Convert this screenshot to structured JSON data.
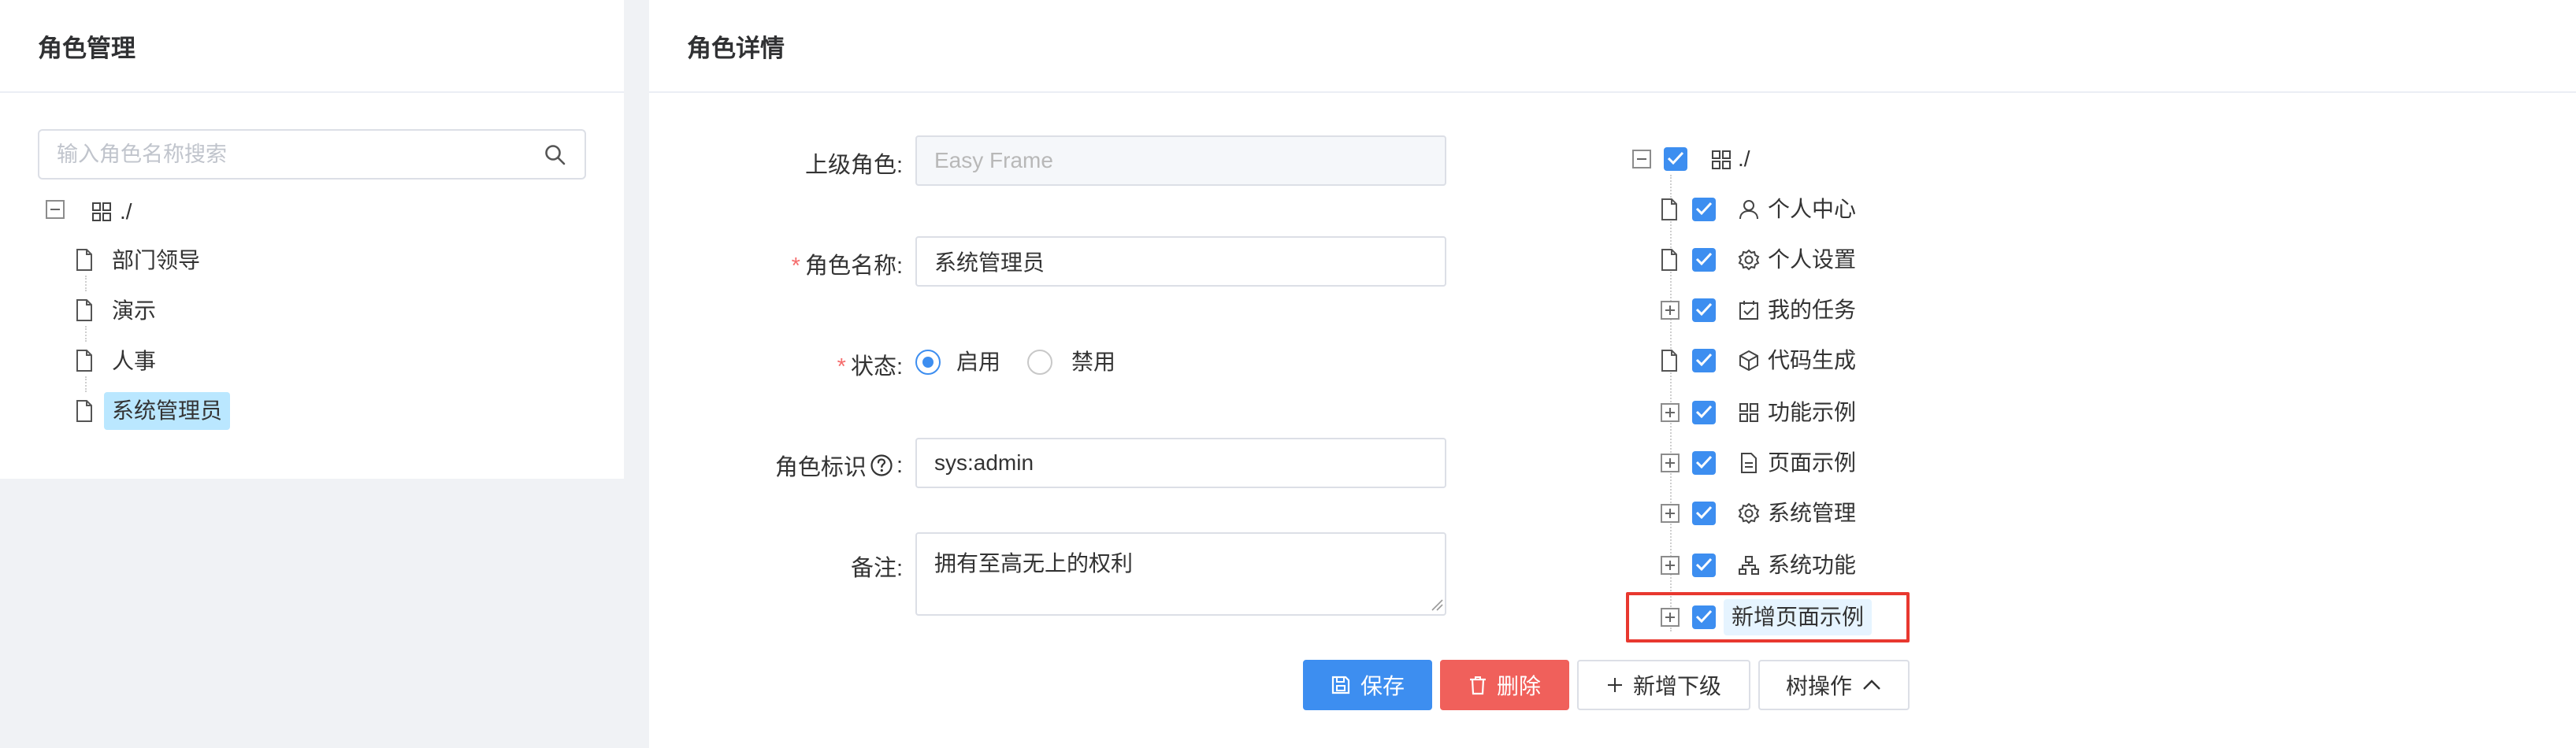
{
  "left_panel": {
    "title": "角色管理",
    "search": {
      "placeholder": "输入角色名称搜索",
      "value": ""
    },
    "tree": {
      "root_label": "./",
      "children": [
        "部门领导",
        "演示",
        "人事",
        "系统管理员"
      ],
      "selected": "系统管理员"
    }
  },
  "right_panel": {
    "title": "角色详情",
    "form": {
      "parent_role": {
        "label": "上级角色:",
        "value": "Easy Frame"
      },
      "role_name": {
        "label": "角色名称:",
        "required_mark": "*",
        "value": "系统管理员"
      },
      "status": {
        "label": "状态:",
        "required_mark": "*",
        "options": [
          "启用",
          "禁用"
        ],
        "selected": "启用"
      },
      "role_key": {
        "label": "角色标识",
        "colon": ":",
        "value": "sys:admin"
      },
      "remark": {
        "label": "备注:",
        "value": "拥有至高无上的权利"
      }
    },
    "perm_tree": {
      "root_label": "./",
      "items": [
        {
          "label": "个人中心",
          "icon": "user-icon",
          "leaf": true
        },
        {
          "label": "个人设置",
          "icon": "settings-icon",
          "leaf": true
        },
        {
          "label": "我的任务",
          "icon": "task-icon",
          "leaf": false
        },
        {
          "label": "代码生成",
          "icon": "code-cube-icon",
          "leaf": true
        },
        {
          "label": "功能示例",
          "icon": "grid-icon",
          "leaf": false
        },
        {
          "label": "页面示例",
          "icon": "page-icon",
          "leaf": false
        },
        {
          "label": "系统管理",
          "icon": "settings-icon",
          "leaf": false
        },
        {
          "label": "系统功能",
          "icon": "org-icon",
          "leaf": false
        },
        {
          "label": "新增页面示例",
          "icon": "",
          "leaf": false
        }
      ]
    },
    "buttons": {
      "save": "保存",
      "delete": "删除",
      "add_child": "新增下级",
      "tree_ops": "树操作"
    }
  },
  "colors": {
    "primary": "#3d8ef0",
    "danger": "#f0605b",
    "highlight": "#e8382f",
    "selected_bg": "#bae7ff"
  }
}
